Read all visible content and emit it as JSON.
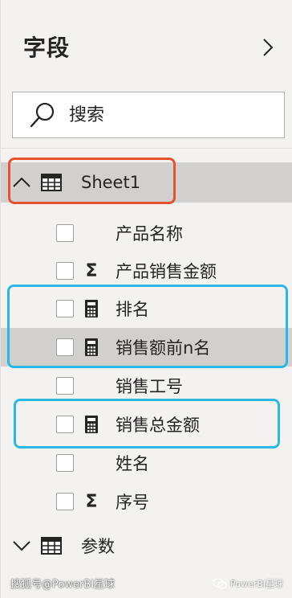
{
  "pane": {
    "title": "字段"
  },
  "search": {
    "placeholder": "搜索",
    "value": ""
  },
  "tables": [
    {
      "name": "Sheet1",
      "expanded": true,
      "fields": [
        {
          "name": "产品名称",
          "type": "none"
        },
        {
          "name": "产品销售金额",
          "type": "sigma"
        },
        {
          "name": "排名",
          "type": "measure"
        },
        {
          "name": "销售额前n名",
          "type": "measure"
        },
        {
          "name": "销售工号",
          "type": "none"
        },
        {
          "name": "销售总金额",
          "type": "measure"
        },
        {
          "name": "姓名",
          "type": "none"
        },
        {
          "name": "序号",
          "type": "sigma"
        }
      ]
    },
    {
      "name": "参数",
      "expanded": false
    }
  ],
  "glyphs": {
    "sigma": "Σ"
  },
  "watermark": {
    "left": "搜狐号@PowerBI星球",
    "right": "PowerBI星球"
  },
  "colors": {
    "pane_bg": "#f3f2f1",
    "selected_bg": "#d2d0ce",
    "highlight_red": "#e5532c",
    "highlight_blue": "#2bb8e6"
  }
}
